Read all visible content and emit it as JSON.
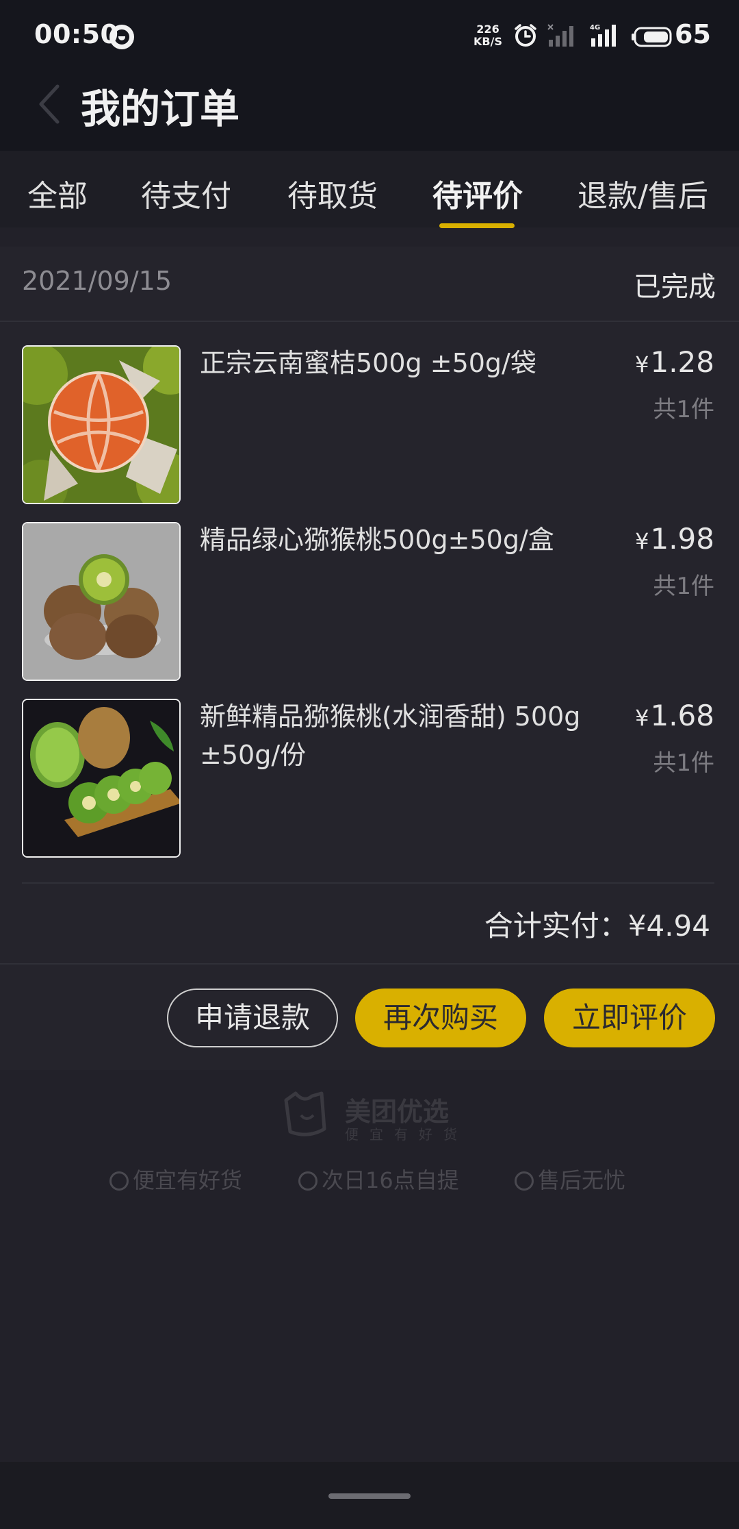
{
  "status_bar": {
    "time": "00:50",
    "net_speed_value": "226",
    "net_speed_unit": "KB/S",
    "network_type": "4G",
    "battery": "65"
  },
  "header": {
    "title": "我的订单",
    "back_icon": "chevron-left-icon"
  },
  "tabs": [
    {
      "label": "全部",
      "active": false
    },
    {
      "label": "待支付",
      "active": false
    },
    {
      "label": "待取货",
      "active": false
    },
    {
      "label": "待评价",
      "active": true
    },
    {
      "label": "退款/售后",
      "active": false
    }
  ],
  "order": {
    "date": "2021/09/15",
    "status": "已完成",
    "items": [
      {
        "name": "正宗云南蜜桔500g ±50g/袋",
        "price": "1.28",
        "qty": "共1件",
        "image": "mandarin-orange-image"
      },
      {
        "name": "精品绿心猕猴桃500g±50g/盒",
        "price": "1.98",
        "qty": "共1件",
        "image": "kiwi-bowl-image"
      },
      {
        "name": "新鲜精品猕猴桃(水润香甜) 500g ±50g/份",
        "price": "1.68",
        "qty": "共1件",
        "image": "sliced-kiwi-image"
      }
    ],
    "currency": "¥",
    "total_label": "合计实付：",
    "total_value": "¥4.94",
    "buttons": {
      "refund": "申请退款",
      "rebuy": "再次购买",
      "rate": "立即评价"
    }
  },
  "footer": {
    "brand": "美团优选",
    "slogan": "便宜有好货",
    "features": [
      "便宜有好货",
      "次日16点自提",
      "售后无忧"
    ]
  },
  "colors": {
    "accent": "#d9b000",
    "background": "#222129",
    "card": "#25242c",
    "header": "#15161d"
  }
}
